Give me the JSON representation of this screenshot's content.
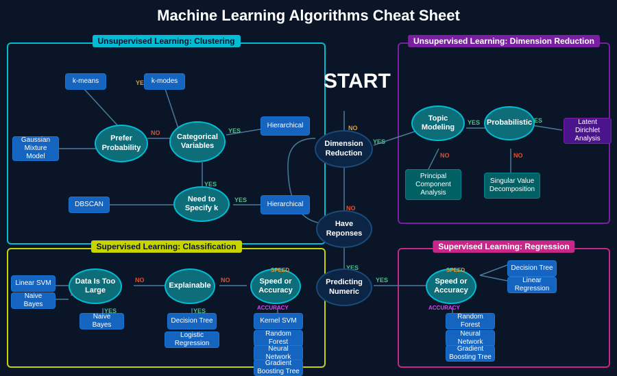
{
  "title": "Machine Learning Algorithms Cheat Sheet",
  "sections": {
    "unsup_cluster": "Unsupervised Learning: Clustering",
    "sup_class": "Supervised Learning: Classification",
    "unsup_dim": "Unsupervised Learning: Dimension Reduction",
    "sup_reg": "Supervised Learning: Regression"
  },
  "nodes": {
    "start": "START",
    "prefer_prob": "Prefer Probability",
    "cat_vars": "Categorical Variables",
    "need_specify_k": "Need to Specify k",
    "hierarchical1": "Hierarchical",
    "hierarchical2": "Hierarchical",
    "gaussian": "Gaussian Mixture Model",
    "dbscan": "DBSCAN",
    "k_means": "k-means",
    "k_modes": "k-modes",
    "dimension_reduction": "Dimension Reduction",
    "have_reponses": "Have Reponses",
    "topic_modeling": "Topic Modeling",
    "probabilistic": "Probabilistic",
    "latent_dirichlet": "Latent Dirichlet Analysis",
    "pca": "Principal Component Analysis",
    "svd": "Singular Value Decomposition",
    "predicting_numeric": "Predicting Numeric",
    "data_too_large": "Data Is Too Large",
    "explainable": "Explainable",
    "speed_or_accuracy1": "Speed or Accuracy",
    "speed_or_accuracy2": "Speed or Accuracy",
    "linear_svm": "Linear SVM",
    "naive_bayes1": "Naive Bayes",
    "naive_bayes2": "Naive Bayes",
    "decision_tree1": "Decision Tree",
    "logistic_regression": "Logistic Regression",
    "kernel_svm": "Kernel SVM",
    "random_forest1": "Random Forest",
    "neural_network1": "Neural Network",
    "gradient_boosting1": "Gradient Boosting Tree",
    "decision_tree2": "Decision Tree",
    "linear_regression": "Linear Regression",
    "random_forest2": "Random Forest",
    "neural_network2": "Neural Network",
    "gradient_boosting2": "Gradient Boosting Tree"
  },
  "labels": {
    "yes": "YES",
    "no": "NO",
    "speed": "SPEED",
    "accuracy": "ACCURACY"
  }
}
